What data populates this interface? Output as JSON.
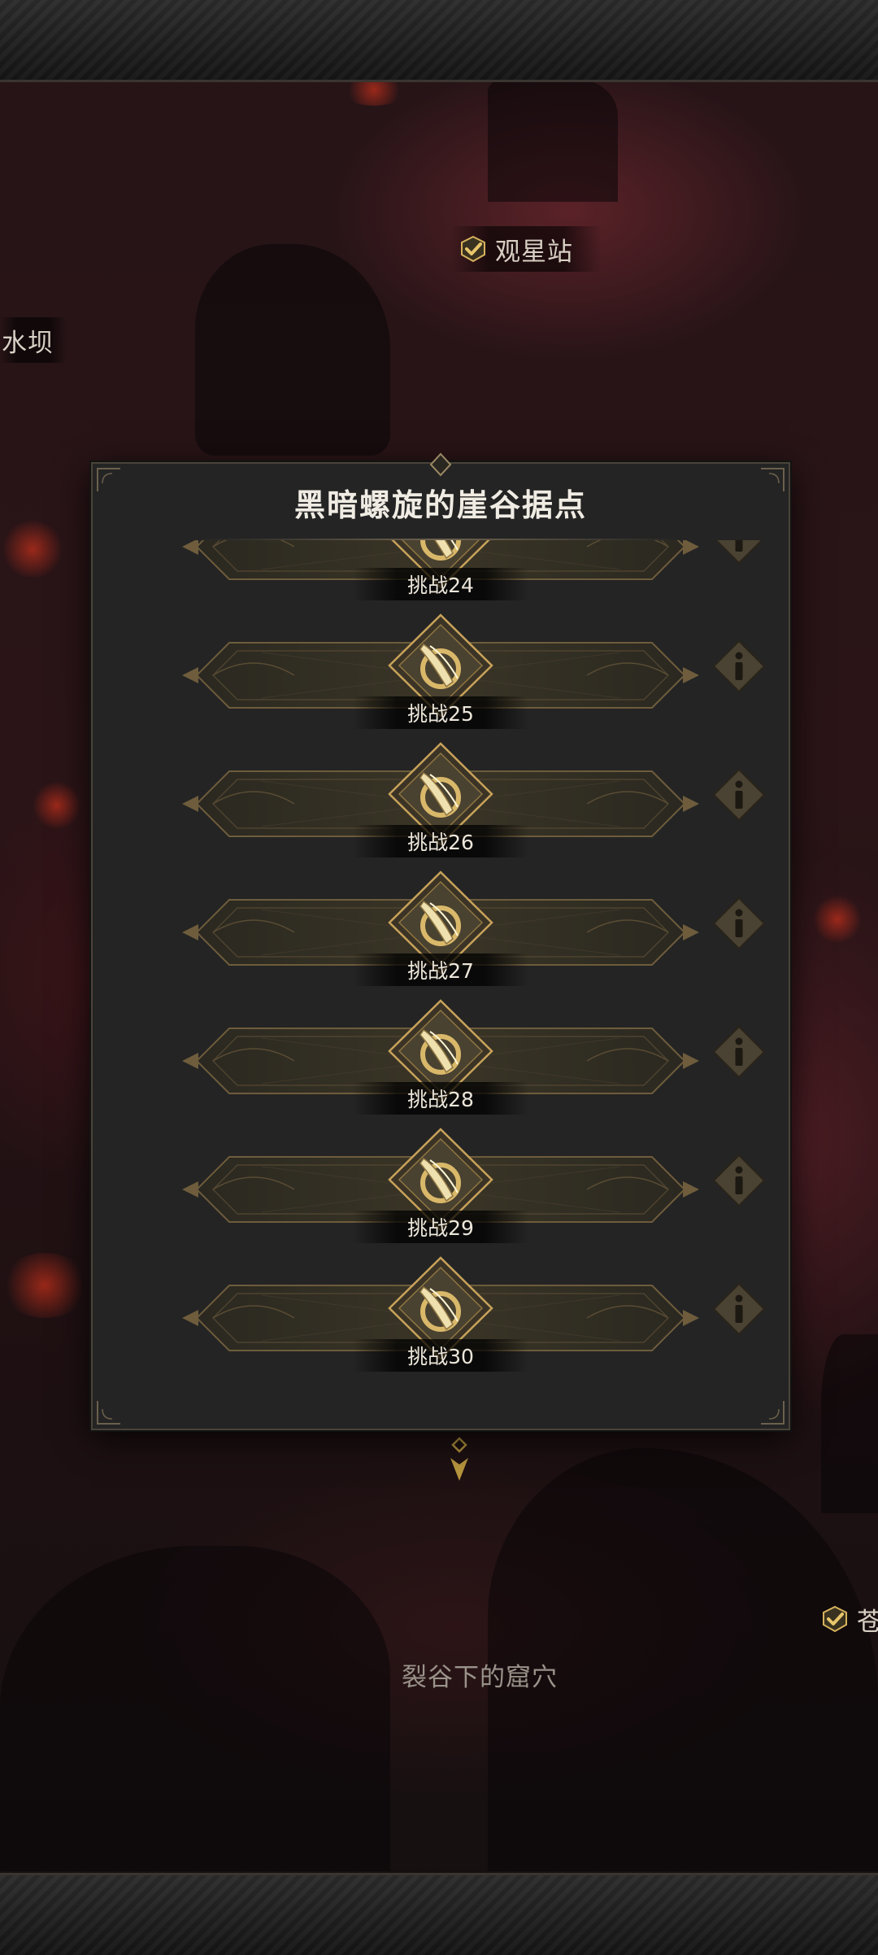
{
  "map": {
    "location_observatory": "观星站",
    "location_dam": "水坝",
    "location_cave": "裂谷下的窟穴",
    "location_partial": "苍"
  },
  "modal": {
    "title": "黑暗螺旋的崖谷据点",
    "challenges": [
      {
        "label": "挑战24"
      },
      {
        "label": "挑战25"
      },
      {
        "label": "挑战26"
      },
      {
        "label": "挑战27"
      },
      {
        "label": "挑战28"
      },
      {
        "label": "挑战29"
      },
      {
        "label": "挑战30"
      }
    ]
  },
  "icons": {
    "challenge": "sword-ring-icon",
    "info": "info-icon",
    "cleared": "check-icon",
    "marker": "down-arrow-marker-icon"
  },
  "colors": {
    "accent_gold": "#c8a25a",
    "panel": "#242424",
    "check_gold": "#d6b25c"
  }
}
